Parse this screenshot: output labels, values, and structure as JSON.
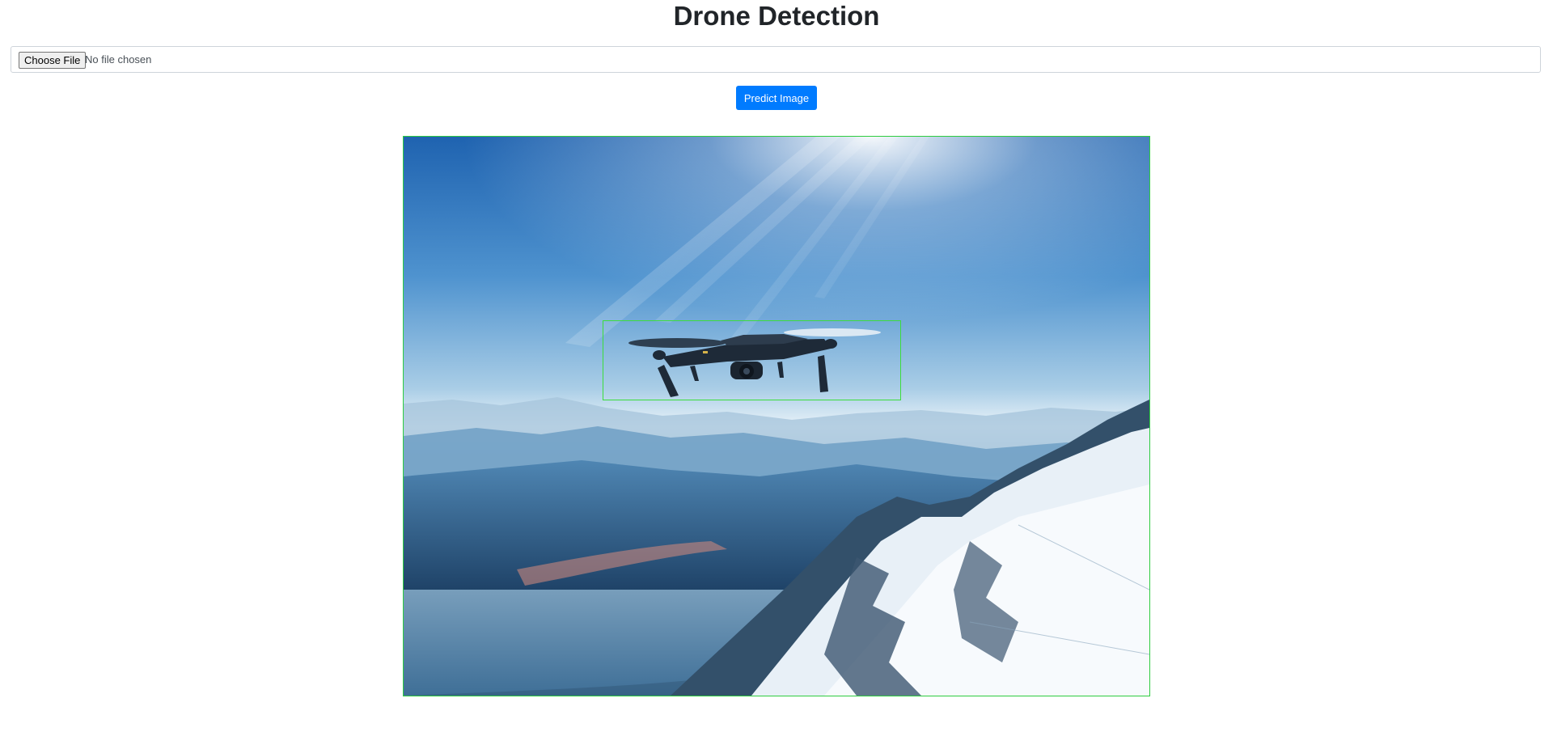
{
  "header": {
    "title": "Drone Detection"
  },
  "upload": {
    "choose_file_label": "Choose File",
    "file_status": "No file chosen"
  },
  "actions": {
    "predict_label": "Predict Image"
  },
  "result": {
    "image_description": "drone-over-mountains-photo",
    "frame_color": "#2ecc40",
    "detection_color": "#3cdc3c",
    "detection_count": 1
  },
  "colors": {
    "primary_button": "#007bff",
    "text": "#212529"
  }
}
